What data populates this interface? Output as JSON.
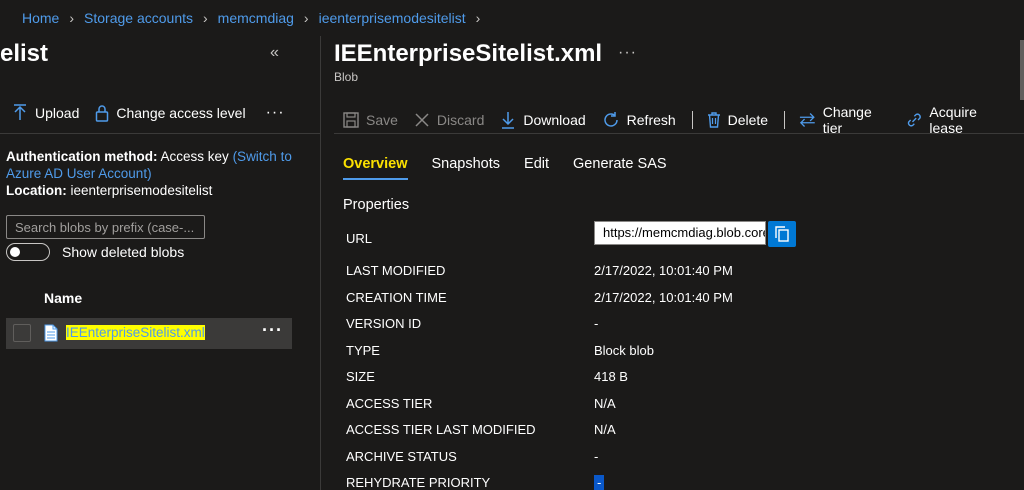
{
  "breadcrumb": {
    "items": [
      "Home",
      "Storage accounts",
      "memcmdiag",
      "ieenterprisemodesitelist"
    ]
  },
  "left_blade": {
    "title": "elist",
    "collapse_glyph": "«",
    "toolbar": {
      "upload": "Upload",
      "change_access": "Change access level",
      "more": "···"
    },
    "auth": {
      "method_label": "Authentication method:",
      "method_value": "Access key",
      "switch_link": "(Switch to Azure AD User Account)",
      "location_label": "Location:",
      "location_value": "ieenterprisemodesitelist"
    },
    "search_placeholder": "Search blobs by prefix (case-...",
    "show_deleted_label": "Show deleted blobs",
    "name_header": "Name",
    "rows": [
      {
        "name": "IEEnterpriseSitelist.xml",
        "more": "···"
      }
    ]
  },
  "blob": {
    "title": "IEEnterpriseSitelist.xml",
    "more": "···",
    "subtitle": "Blob",
    "toolbar": {
      "save": "Save",
      "discard": "Discard",
      "download": "Download",
      "refresh": "Refresh",
      "delete": "Delete",
      "change_tier": "Change tier",
      "acquire_lease": "Acquire lease"
    },
    "tabs": [
      "Overview",
      "Snapshots",
      "Edit",
      "Generate SAS"
    ],
    "properties_title": "Properties",
    "url_label": "URL",
    "url_value": "https://memcmdiag.blob.core.windows.net/ieenterprisemodesitelist/IEEnterpriseSitelist.xml",
    "properties": [
      {
        "label": "LAST MODIFIED",
        "value": "2/17/2022, 10:01:40 PM"
      },
      {
        "label": "CREATION TIME",
        "value": "2/17/2022, 10:01:40 PM"
      },
      {
        "label": "VERSION ID",
        "value": "-"
      },
      {
        "label": "TYPE",
        "value": "Block blob"
      },
      {
        "label": "SIZE",
        "value": "418 B"
      },
      {
        "label": "ACCESS TIER",
        "value": "N/A"
      },
      {
        "label": "ACCESS TIER LAST MODIFIED",
        "value": "N/A"
      },
      {
        "label": "ARCHIVE STATUS",
        "value": "-"
      },
      {
        "label": "REHYDRATE PRIORITY",
        "value": "-"
      }
    ]
  },
  "colors": {
    "background": "#1b1a19",
    "link": "#4f9bea",
    "active_tab": "#fce100",
    "highlight": "#ffff00",
    "accent": "#0078d4"
  }
}
